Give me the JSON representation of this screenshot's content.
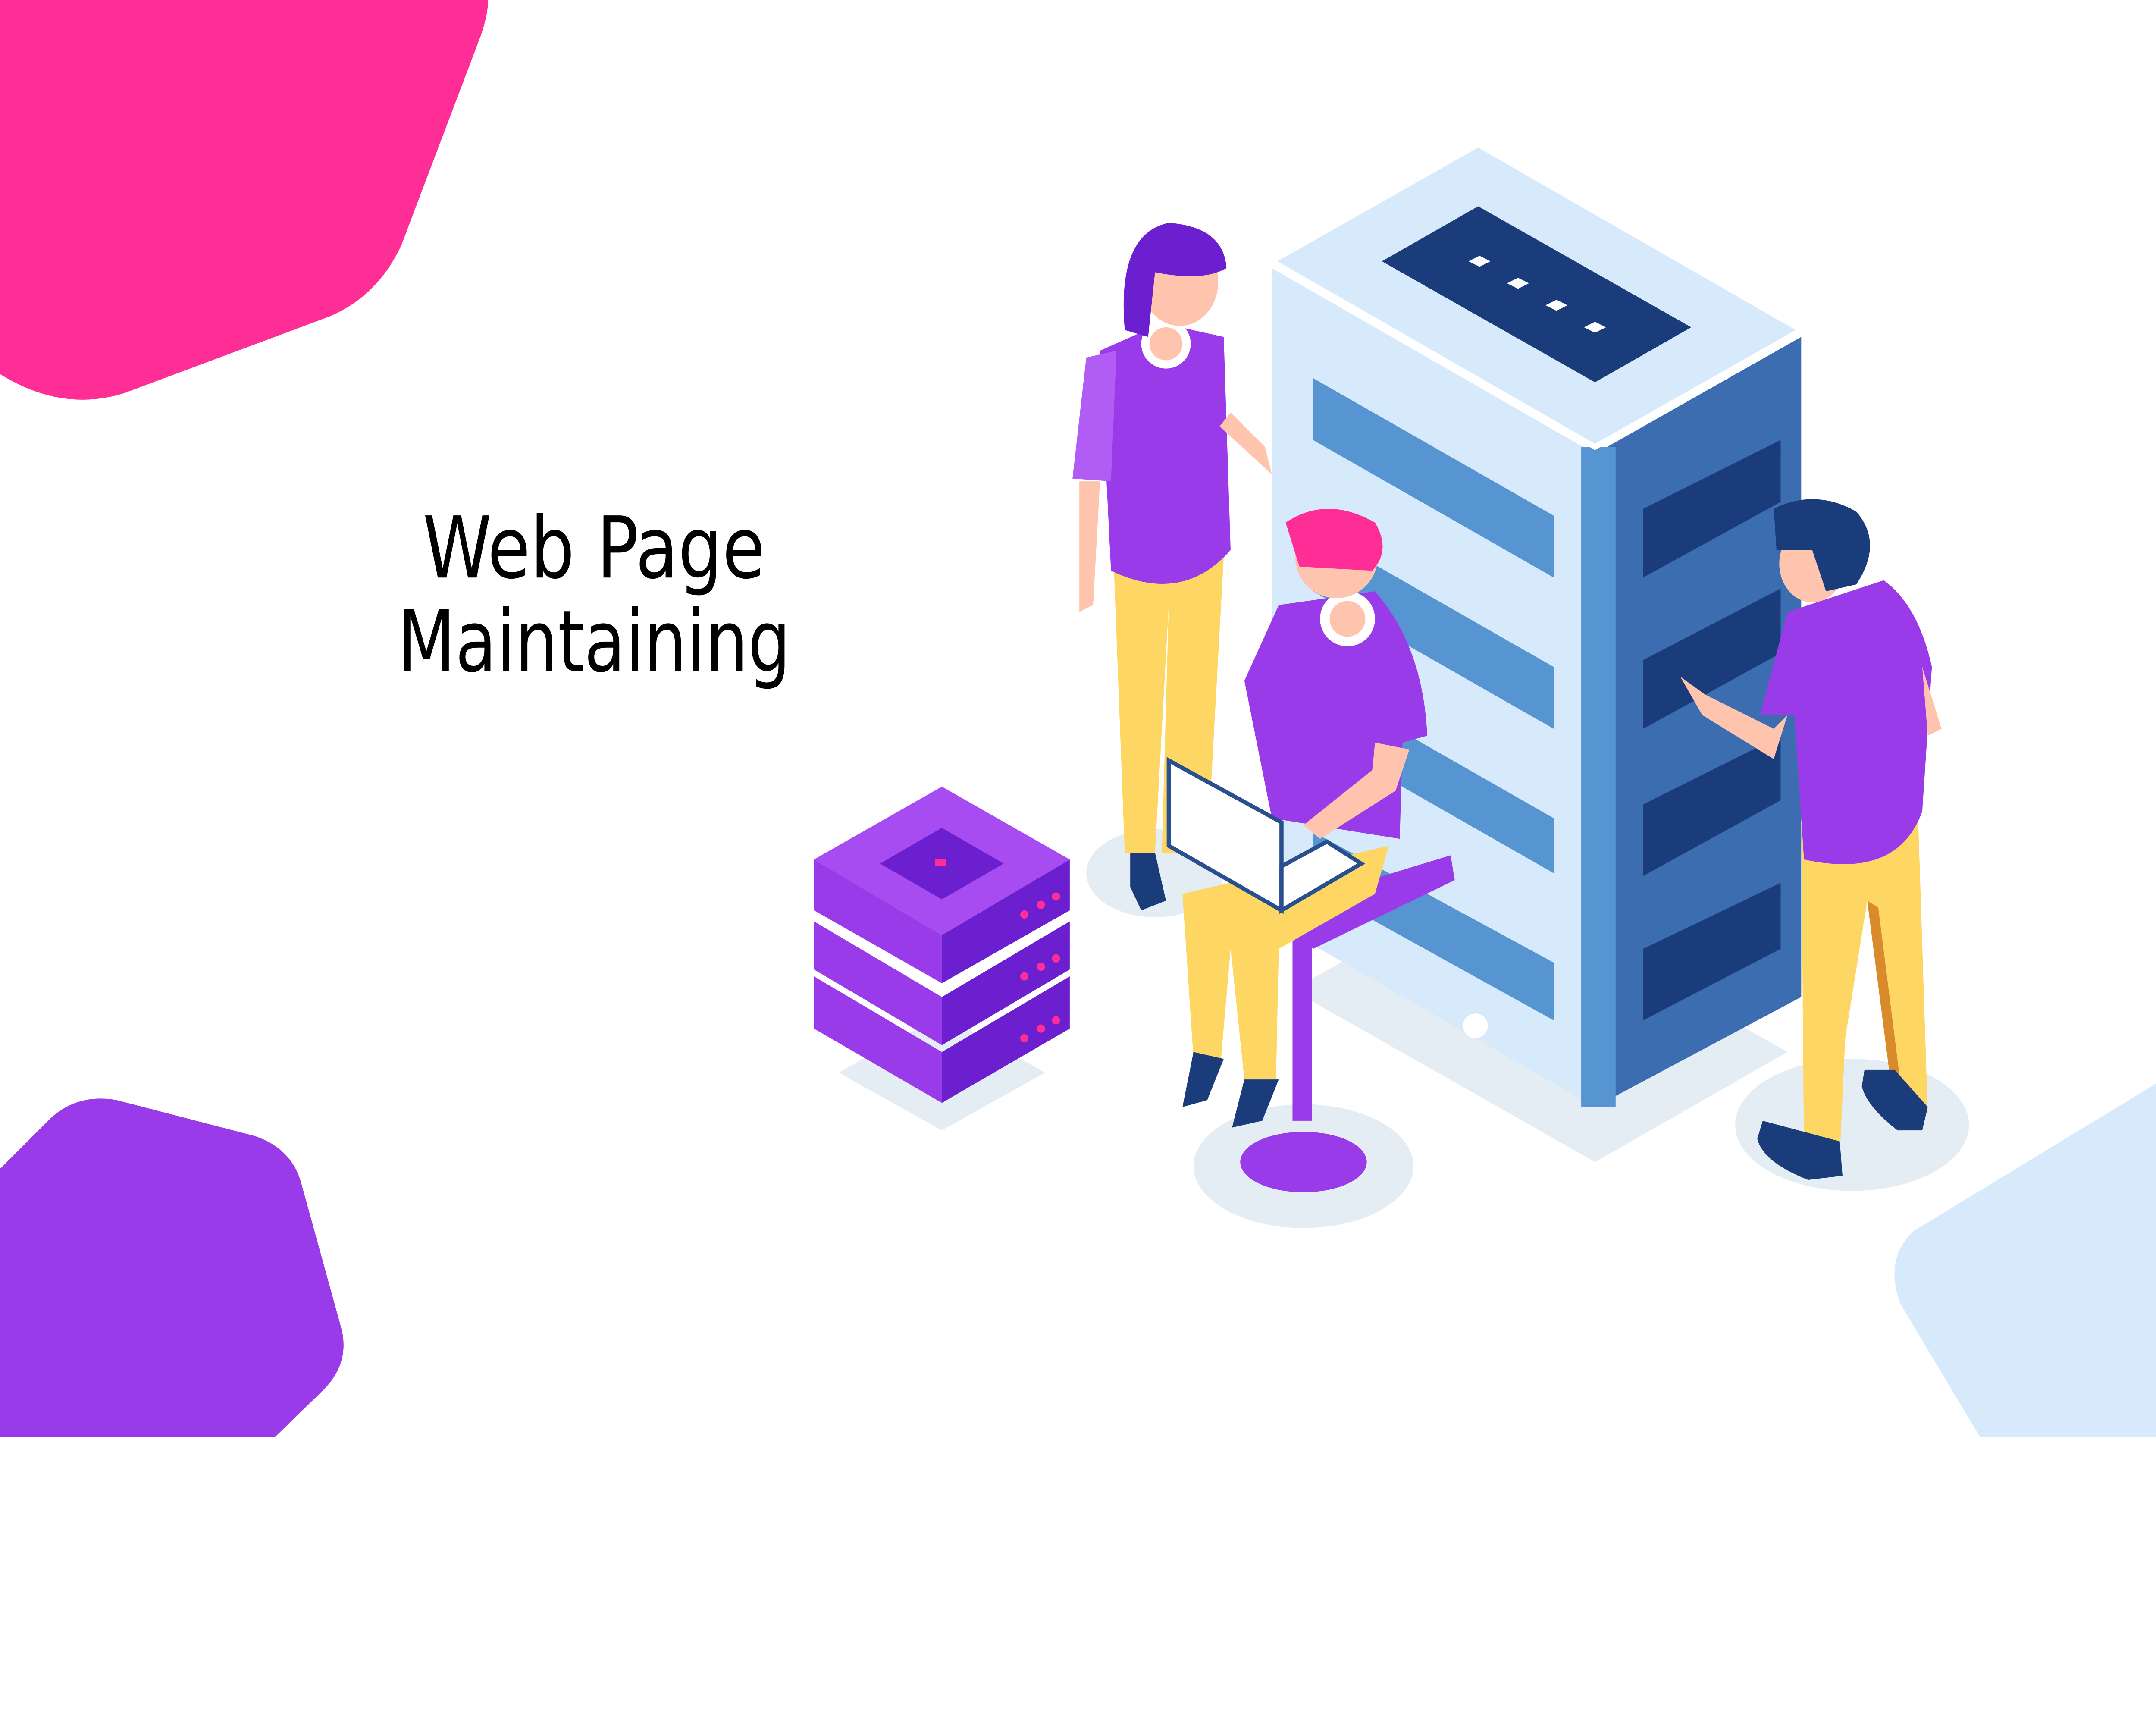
{
  "headline": {
    "line1": "Web Page",
    "line2": "Maintaining"
  },
  "colors": {
    "pink_blob": "#ff2d96",
    "purple_blob": "#993be8",
    "light_blue_blob": "#d6eafc",
    "server_light": "#d6eafc",
    "server_mid": "#5694d2",
    "server_dark": "#3b6db0",
    "server_navy": "#1a3c7a",
    "purple": "#9a3be9",
    "yellow": "#fdd663",
    "skin": "#ffc4ae"
  },
  "illustration": {
    "subject": "isometric server rack with three people maintaining it",
    "icons": [
      "server-rack-icon",
      "server-stack-icon",
      "laptop-icon"
    ]
  }
}
